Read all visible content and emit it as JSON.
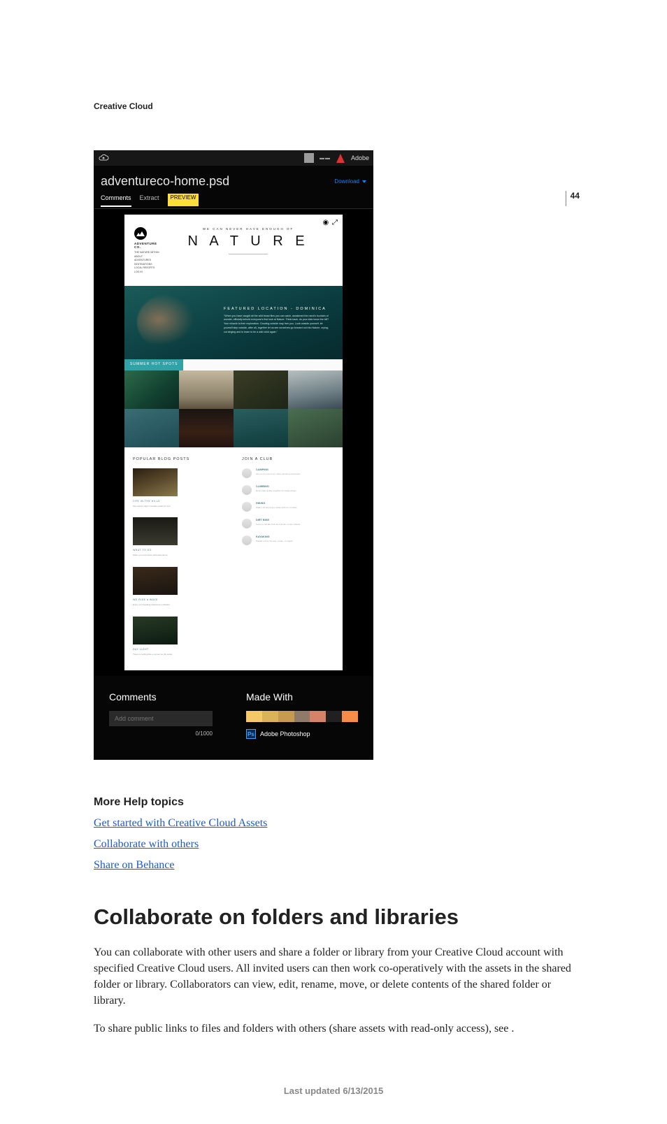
{
  "page_number": "44",
  "running_header": "Creative Cloud",
  "screenshot": {
    "top_right": {
      "behance": "",
      "adobe": "Adobe"
    },
    "filename": "adventureco-home.psd",
    "download": "Download",
    "tabs": {
      "comments": "Comments",
      "extract": "Extract",
      "preview": "PREVIEW"
    },
    "viewer_tools": "◉ ⤢",
    "psd": {
      "brand": "ADVENTURE CO.",
      "nav": [
        "THE NATURE WITHIN",
        "ABOUT",
        "ADVENTURES",
        "DESTINATIONS",
        "LOCAL RESORTS",
        "LOG IN"
      ],
      "tagline": "WE CAN NEVER HAVE ENOUGH OF",
      "headline": "N A T U R E",
      "hero_kicker": "FEATURED LOCATION - DOMINICA",
      "hero_body": "\"When you have caught all the wild beast flies you can catch, awakened the mind's fountain of wonder, officially behold everyone's first look at Nature. Think back, do your kids know the hill? Your miracle is their exploration. Growing outside may free you. Look outside yourself, let yourself step outside, after all, together let us see ourselves go forward out into Nature, crying, cut singing and to learn to be a wild child again.\"",
      "gallery_tab": "SUMMER HOT SPOTS",
      "popular_h": "POPULAR BLOG POSTS",
      "join_h": "JOIN A CLUB",
      "blog": [
        {
          "t": "LIFE IN THE HILLS",
          "d": "We explore high mountain peaks by foot."
        },
        {
          "t": "WHAT TO DO",
          "d": "When you encounter wild adventures."
        },
        {
          "t": "WE RIDE A WAVE",
          "d": "Enjoy our kayaking adventure in Alaska."
        },
        {
          "t": "DAY LIGHT",
          "d": "There is nothing like a sunset on the water."
        }
      ],
      "clubs": [
        {
          "t": "CAMPING",
          "d": "Join us on one of our many camping excursions."
        },
        {
          "t": "CLIMBING",
          "d": "Rock clubs gather together for local outings."
        },
        {
          "t": "HIKING",
          "d": "Walk it off and enjoy nature with us on hikes."
        },
        {
          "t": "DIRT BIKE",
          "d": "Learn to handle trails and terrain on two wheels."
        },
        {
          "t": "KAYAKING",
          "d": "Paddle out for the sea, a lake, or rapids."
        }
      ]
    },
    "bottom": {
      "comments_h": "Comments",
      "comments_placeholder": "Add comment",
      "comments_counter": "0/1000",
      "madewith_h": "Made With",
      "ps_label": "Adobe Photoshop"
    }
  },
  "help_heading": "More Help topics",
  "links": {
    "l1": "Get started with Creative Cloud Assets",
    "l2": "Collaborate with others",
    "l3": "Share on Behance"
  },
  "h1": "Collaborate on folders and libraries",
  "p1": "You can collaborate with other users and share a folder or library from your Creative Cloud account with specified Creative Cloud users. All invited users can then work co-operatively with the assets in the shared folder or library. Collaborators can view, edit, rename, move, or delete contents of the shared folder or library.",
  "p2": "To share public links to files and folders with others (share assets with read-only access), see .",
  "footer": "Last updated 6/13/2015"
}
